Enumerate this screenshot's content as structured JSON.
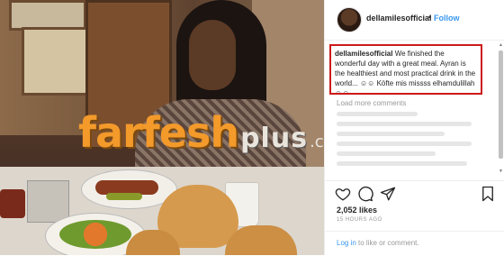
{
  "watermark": {
    "brand": "farfesh",
    "suffix": "plus",
    "tld": ".com"
  },
  "post": {
    "username": "dellamilesofficial",
    "separator": "•",
    "follow_label": "Follow",
    "caption": {
      "username": "dellamilesofficial",
      "text": "We finished the wonderful day with a great meal. Ayran is the healthiest and most practical drink in the world... ☺☺ Köfte mis missss elhamdulillah ☺☺"
    },
    "load_more": "Load more comments",
    "likes": "2,052 likes",
    "timestamp": "15 HOURS AGO",
    "login": {
      "link": "Log in",
      "rest": " to like or comment."
    }
  },
  "icons": {
    "like": "heart-icon",
    "comment": "comment-bubble-icon",
    "share": "share-plane-icon",
    "save": "bookmark-icon",
    "scroll_up": "scroll-up-arrow-icon",
    "scroll_down": "scroll-down-arrow-icon"
  },
  "colors": {
    "link_blue": "#3897f0",
    "highlight_red": "#cc1a1a",
    "watermark_orange": "#f39a2b"
  }
}
